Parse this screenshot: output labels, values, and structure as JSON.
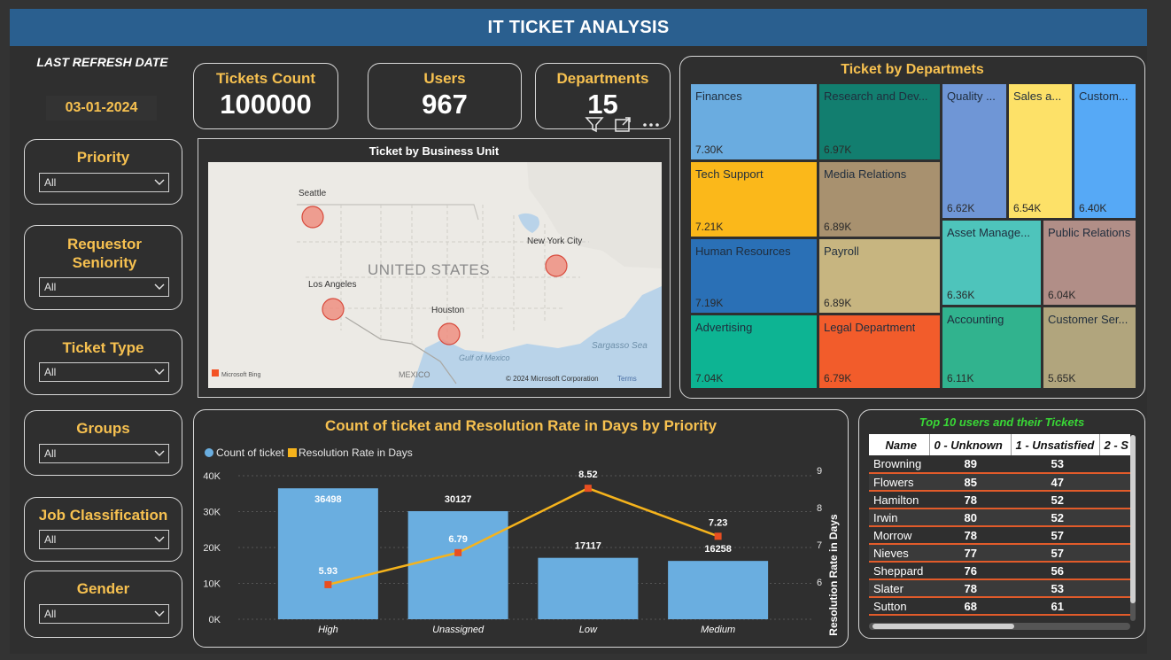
{
  "header": {
    "title": "IT TICKET ANALYSIS"
  },
  "refresh": {
    "label": "LAST REFRESH DATE",
    "date": "03-01-2024"
  },
  "kpis": [
    {
      "label": "Tickets Count",
      "value": "100000"
    },
    {
      "label": "Users",
      "value": "967"
    },
    {
      "label": "Departments",
      "value": "15"
    }
  ],
  "slicers": [
    {
      "label": "Priority",
      "value": "All"
    },
    {
      "label": "Requestor Seniority",
      "value": "All"
    },
    {
      "label": "Ticket Type",
      "value": "All"
    },
    {
      "label": "Groups",
      "value": "All"
    },
    {
      "label": "Job Classification",
      "value": "All"
    },
    {
      "label": "Gender",
      "value": "All"
    }
  ],
  "map": {
    "title": "Ticket by Business Unit",
    "country_label": "UNITED STATES",
    "cities": [
      "Seattle",
      "New York City",
      "Los Angeles",
      "Houston"
    ],
    "other_labels": [
      "Gulf of Mexico",
      "Sargasso Sea",
      "MEXICO"
    ],
    "attribution": "© 2024 Microsoft Corporation",
    "terms": "Terms",
    "bing": "Microsoft Bing"
  },
  "treemap": {
    "title": "Ticket by Departmets",
    "cells": [
      {
        "name": "Finances",
        "value": "7.30K",
        "color": "#6aace0"
      },
      {
        "name": "Research and Dev...",
        "value": "6.97K",
        "color": "#127e6f"
      },
      {
        "name": "Quality ...",
        "value": "6.62K",
        "color": "#6f96d6"
      },
      {
        "name": "Sales a...",
        "value": "6.54K",
        "color": "#fde168"
      },
      {
        "name": "Custom...",
        "value": "6.40K",
        "color": "#56a9f6"
      },
      {
        "name": "Tech Support",
        "value": "7.21K",
        "color": "#fbb81a"
      },
      {
        "name": "Media Relations",
        "value": "6.89K",
        "color": "#a8916f"
      },
      {
        "name": "Asset Manage...",
        "value": "6.36K",
        "color": "#4ec4bb"
      },
      {
        "name": "Public Relations",
        "value": "6.04K",
        "color": "#b18e87"
      },
      {
        "name": "Human Resources",
        "value": "7.19K",
        "color": "#2a70b6"
      },
      {
        "name": "Payroll",
        "value": "6.89K",
        "color": "#c7b580"
      },
      {
        "name": "Accounting",
        "value": "6.11K",
        "color": "#31b38e"
      },
      {
        "name": "Customer Ser...",
        "value": "5.65K",
        "color": "#b1a57d"
      },
      {
        "name": "Advertising",
        "value": "7.04K",
        "color": "#0db493"
      },
      {
        "name": "Legal Department",
        "value": "6.79K",
        "color": "#f25c2b"
      }
    ]
  },
  "chart_data": {
    "type": "bar",
    "title": "Count of ticket and Resolution Rate in Days by Priority",
    "categories": [
      "High",
      "Unassigned",
      "Low",
      "Medium"
    ],
    "series": [
      {
        "name": "Count of ticket",
        "type": "bar",
        "values": [
          36498,
          30127,
          17117,
          16258
        ],
        "color": "#6aaee0"
      },
      {
        "name": "Resolution Rate in Days",
        "type": "line",
        "values": [
          5.93,
          6.79,
          8.52,
          7.23
        ],
        "color": "#f5b31c",
        "marker_color": "#e84e21"
      }
    ],
    "y_left": {
      "ticks": [
        "0K",
        "10K",
        "20K",
        "30K",
        "40K"
      ],
      "range": [
        0,
        40000
      ]
    },
    "y_right": {
      "label": "Resolution Rate in Days",
      "ticks": [
        "6",
        "7",
        "8",
        "9"
      ],
      "range": [
        5.0,
        9.0
      ]
    },
    "legend_position": "top-left",
    "grid": true
  },
  "users_table": {
    "title": "Top 10 users and their Tickets",
    "columns": [
      "Name",
      "0 - Unknown",
      "1 - Unsatisfied",
      "2 - S"
    ],
    "rows": [
      [
        "Browning",
        "89",
        "53"
      ],
      [
        "Flowers",
        "85",
        "47"
      ],
      [
        "Hamilton",
        "78",
        "52"
      ],
      [
        "Irwin",
        "80",
        "52"
      ],
      [
        "Morrow",
        "78",
        "57"
      ],
      [
        "Nieves",
        "77",
        "57"
      ],
      [
        "Sheppard",
        "76",
        "56"
      ],
      [
        "Slater",
        "78",
        "53"
      ],
      [
        "Sutton",
        "68",
        "61"
      ]
    ]
  }
}
